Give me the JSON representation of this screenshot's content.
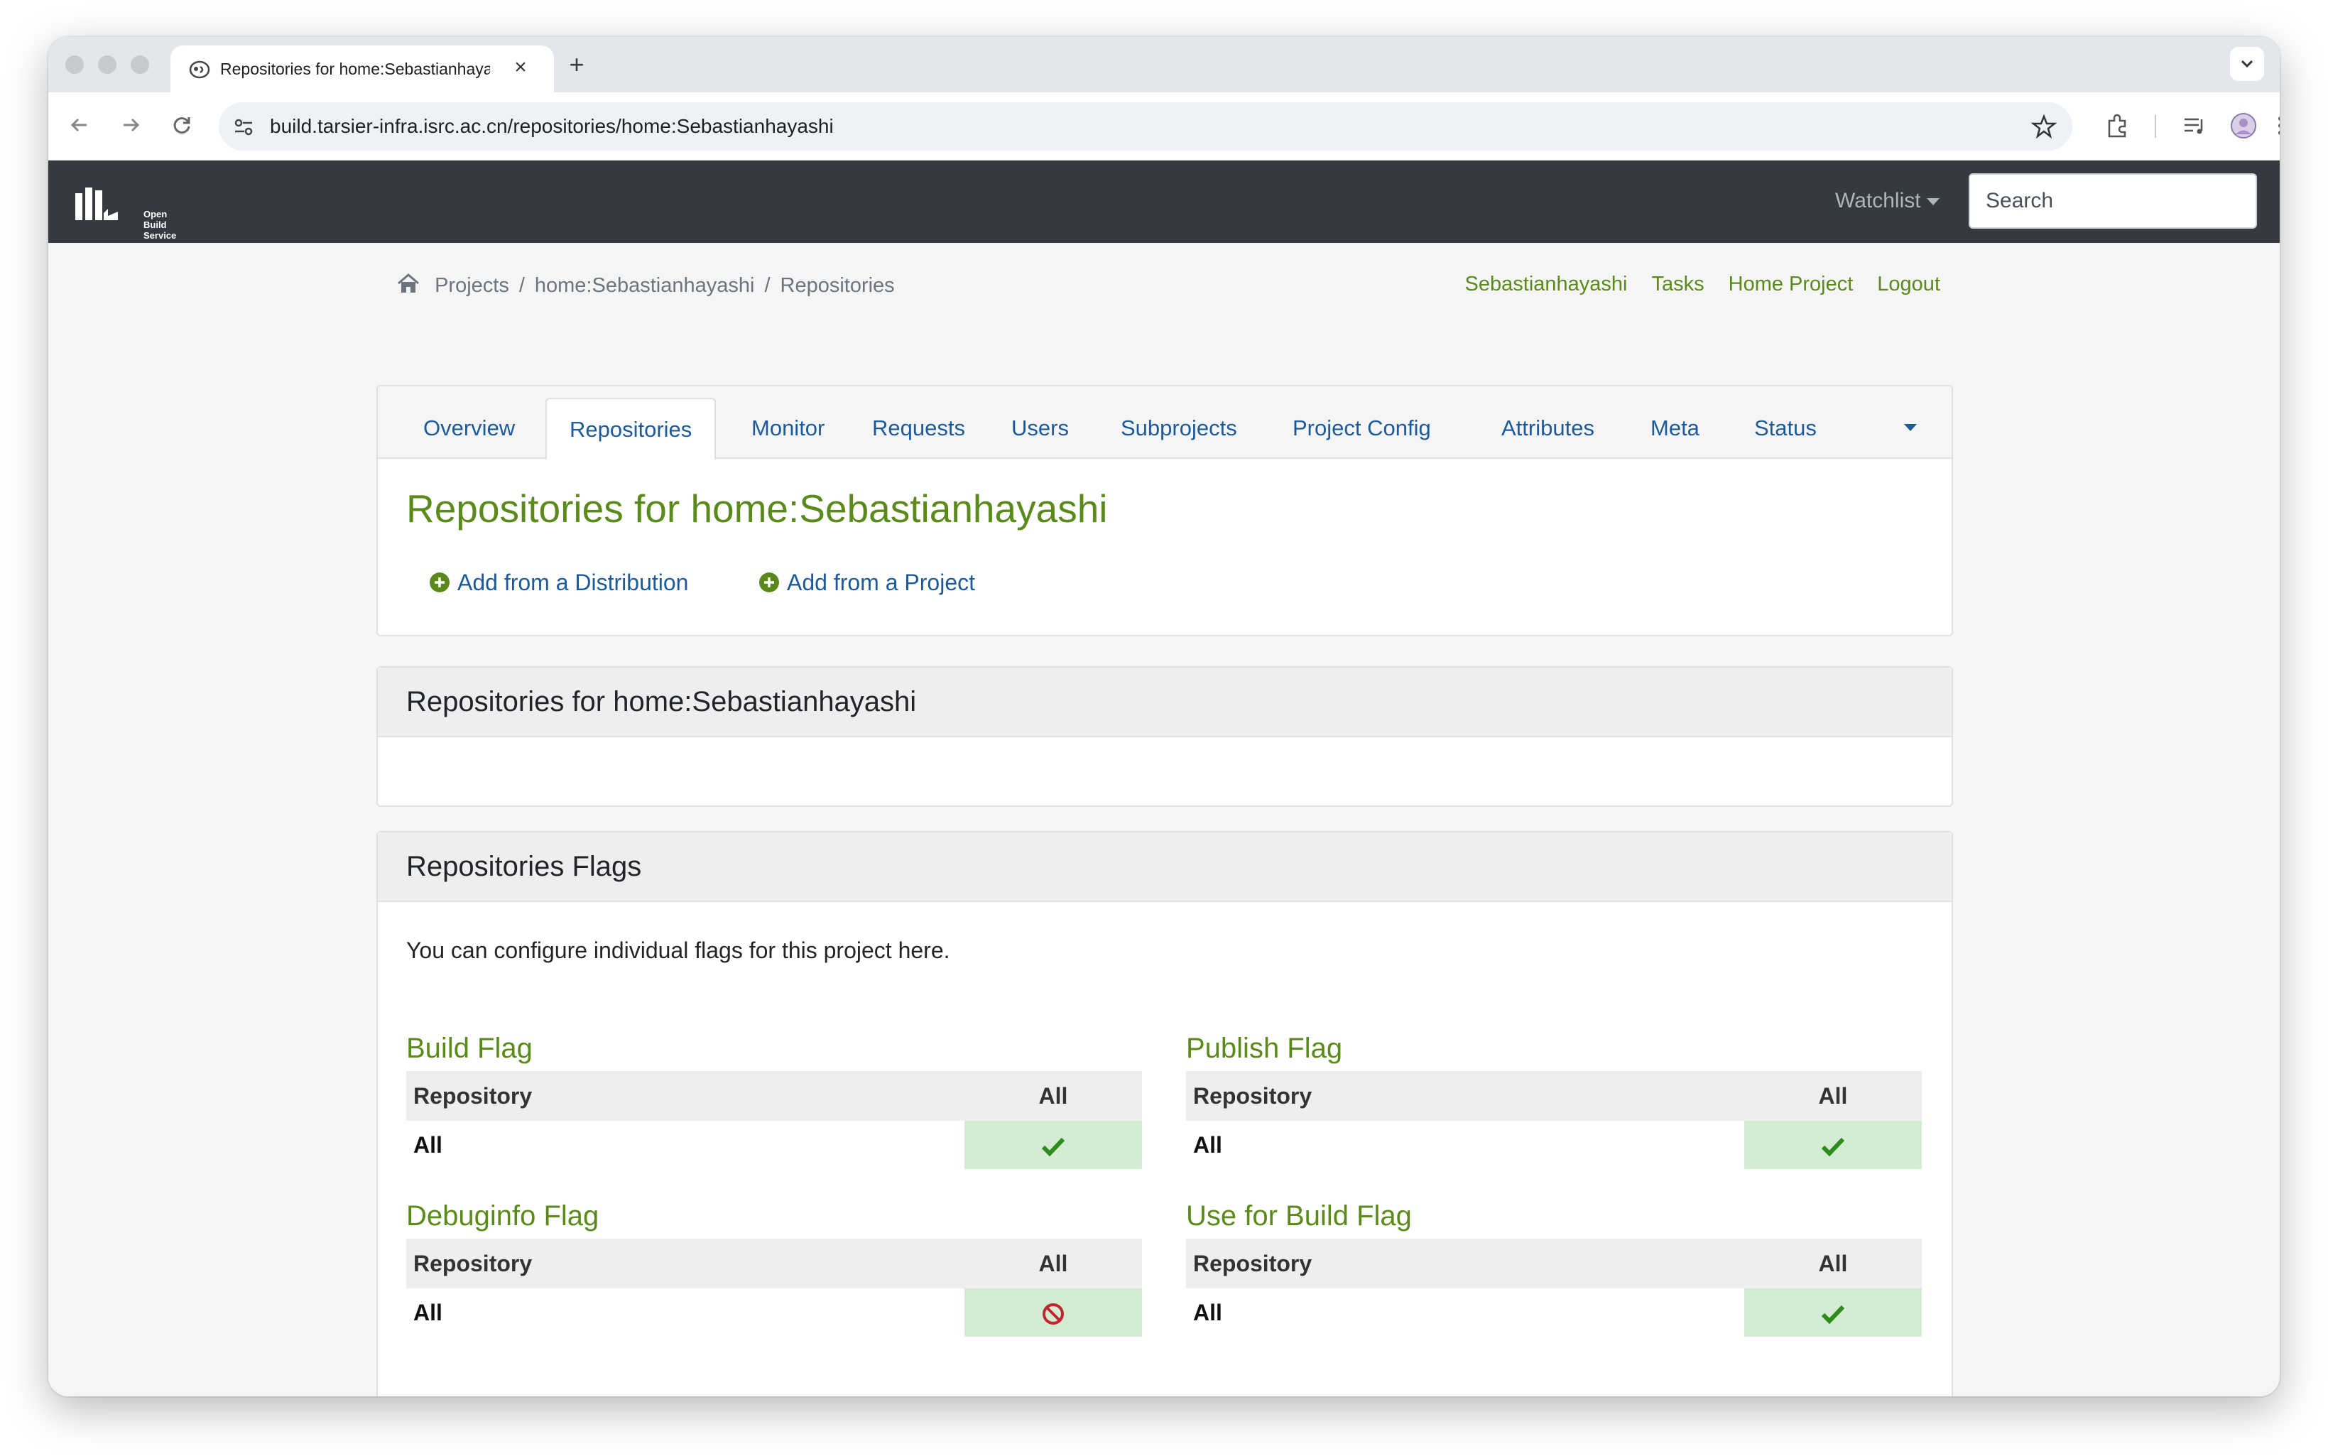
{
  "browser": {
    "tab_title": "Repositories for home:Sebastianhayashi",
    "tab_close": "×",
    "new_tab": "+",
    "url": "build.tarsier-infra.isrc.ac.cn/repositories/home:Sebastianhayashi"
  },
  "header": {
    "logo_lines": [
      "Open",
      "Build",
      "Service"
    ],
    "watchlist": "Watchlist",
    "search_placeholder": "Search"
  },
  "breadcrumb": {
    "items": [
      "Projects",
      "home:Sebastianhayashi",
      "Repositories"
    ],
    "separator": "/"
  },
  "user_nav": [
    "Sebastianhayashi",
    "Tasks",
    "Home Project",
    "Logout"
  ],
  "tabs": [
    "Overview",
    "Repositories",
    "Monitor",
    "Requests",
    "Users",
    "Subprojects",
    "Project Config",
    "Attributes",
    "Meta",
    "Status"
  ],
  "active_tab": "Repositories",
  "page_title": "Repositories for home:Sebastianhayashi",
  "actions": [
    "Add from a Distribution",
    "Add from a Project"
  ],
  "repositories_card": {
    "title": "Repositories for home:Sebastianhayashi"
  },
  "flags_card": {
    "title": "Repositories Flags",
    "intro": "You can configure individual flags for this project here.",
    "flags": [
      {
        "title": "Build Flag",
        "col_repo": "Repository",
        "col_all": "All",
        "row_label": "All",
        "status": "enabled"
      },
      {
        "title": "Publish Flag",
        "col_repo": "Repository",
        "col_all": "All",
        "row_label": "All",
        "status": "enabled"
      },
      {
        "title": "Debuginfo Flag",
        "col_repo": "Repository",
        "col_all": "All",
        "row_label": "All",
        "status": "disabled"
      },
      {
        "title": "Use for Build Flag",
        "col_repo": "Repository",
        "col_all": "All",
        "row_label": "All",
        "status": "enabled"
      }
    ]
  },
  "colors": {
    "accent_green": "#5a8a1a",
    "link_blue": "#1d5a9a",
    "header_dark": "#343a40",
    "enabled_bg": "#d4ecd1",
    "check_green": "#2e8b1e",
    "disabled_red": "#c0262d"
  }
}
